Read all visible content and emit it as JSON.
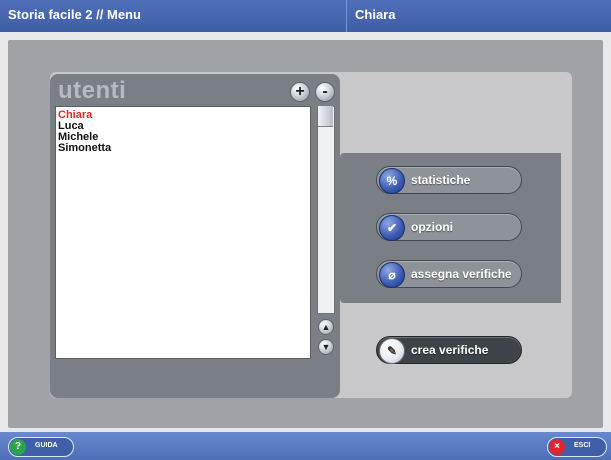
{
  "titlebar": {
    "left_title": "Storia facile 2 // Menu",
    "right_title": "Chiara"
  },
  "users": {
    "title": "utenti",
    "add_symbol": "+",
    "remove_symbol": "-",
    "items": [
      {
        "label": "Chiara",
        "selected": true
      },
      {
        "label": "Luca",
        "selected": false
      },
      {
        "label": "Michele",
        "selected": false
      },
      {
        "label": "Simonetta",
        "selected": false
      }
    ],
    "scroll_up_symbol": "▲",
    "scroll_down_symbol": "▼"
  },
  "actions": [
    {
      "label": "statistiche",
      "icon": "percent-icon",
      "glyph": "%"
    },
    {
      "label": "opzioni",
      "icon": "checkbox-icon",
      "glyph": "✔"
    },
    {
      "label": "assegna verifiche",
      "icon": "paperclip-icon",
      "glyph": "⌀"
    }
  ],
  "create_button": {
    "label": "crea verifiche",
    "icon": "pencil-icon",
    "glyph": "✎"
  },
  "bottombar": {
    "help": {
      "label": "GUIDA",
      "glyph": "?"
    },
    "exit": {
      "label": "ESCI",
      "glyph": "×"
    }
  },
  "colors": {
    "title_bar": "#4f70b8",
    "selected_user": "#e0262a",
    "help_icon": "#2aa64a",
    "exit_icon": "#e0262a"
  }
}
